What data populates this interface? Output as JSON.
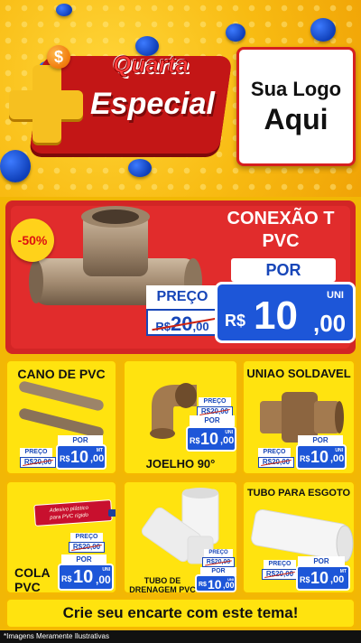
{
  "header": {
    "title_line1": "Quarta",
    "title_line2": "Especial",
    "dollar_symbol": "$",
    "logo_line1": "Sua Logo",
    "logo_line2": "Aqui"
  },
  "featured": {
    "badge": "-50%",
    "name_line1": "CONEXÃO T",
    "name_line2": "PVC",
    "por_label": "POR",
    "preco_label": "PREÇO",
    "old_price_prefix": "R$",
    "old_price_int": "20",
    "old_price_dec": ",00",
    "currency": "R$",
    "new_price_int": "10",
    "new_price_dec": ",00",
    "unit": "UNI"
  },
  "products": [
    {
      "name": "CANO DE PVC",
      "preco_label": "PREÇO",
      "old_price": "R$20,00",
      "por_label": "POR",
      "currency": "R$",
      "int": "10",
      "dec": ",00",
      "unit": "MT"
    },
    {
      "name": "JOELHO 90°",
      "preco_label": "PREÇO",
      "old_price": "R$20,00",
      "por_label": "POR",
      "currency": "R$",
      "int": "10",
      "dec": ",00",
      "unit": "UNI"
    },
    {
      "name": "UNIAO SOLDAVEL",
      "preco_label": "PREÇO",
      "old_price": "R$20,00",
      "por_label": "POR",
      "currency": "R$",
      "int": "10",
      "dec": ",00",
      "unit": "UNI"
    },
    {
      "name_line1": "COLA",
      "name_line2": "PVC",
      "preco_label": "PREÇO",
      "old_price": "R$20,00",
      "por_label": "POR",
      "currency": "R$",
      "int": "10",
      "dec": ",00",
      "unit": "UNI",
      "tube_text1": "Adesivo plástico",
      "tube_text2": "para PVC rígido"
    },
    {
      "name_line1": "TUBO DE",
      "name_line2": "DRENAGEM PVC",
      "preco_label": "PREÇO",
      "old_price": "R$20,00",
      "por_label": "POR",
      "currency": "R$",
      "int": "10",
      "dec": ",00",
      "unit": "UNI"
    },
    {
      "name": "TUBO PARA ESGOTO",
      "preco_label": "PREÇO",
      "old_price": "R$20,00",
      "por_label": "POR",
      "currency": "R$",
      "int": "10",
      "dec": ",00",
      "unit": "MT"
    }
  ],
  "cta": "Crie seu encarte com este tema!",
  "footer": "*Imagens Meramente Ilustrativas",
  "colors": {
    "yellow": "#ffe30f",
    "red": "#d22525",
    "blue": "#1d56d8",
    "price_text": "#1746b8"
  }
}
